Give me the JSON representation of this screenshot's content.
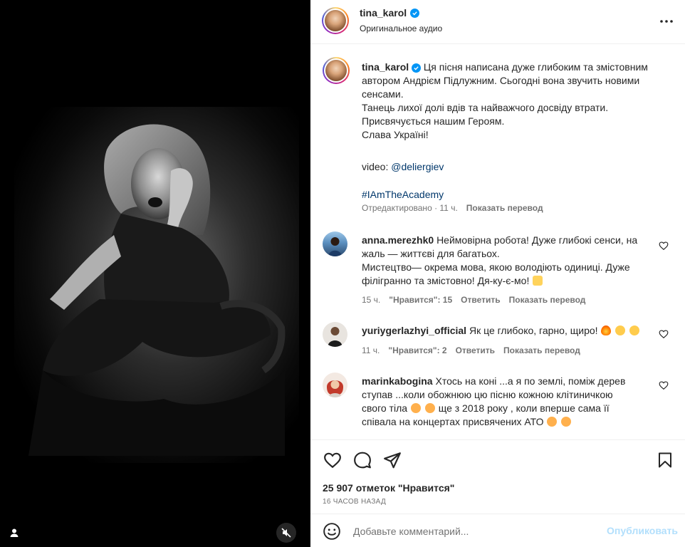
{
  "post": {
    "author": "tina_karol",
    "audio": "Оригинальное аудио",
    "caption_lines": [
      "Ця пісня написана дуже глибоким та змістовним",
      "автором Андрієм Підлужним. Сьогодні вона звучить новими",
      "сенсами.",
      "Танець лихої долі вдів та найважчого досвіду втрати.",
      "Присвячується нашим Героям.",
      "Слава Україні!"
    ],
    "video_label": "video: ",
    "video_mention": "@deliergiev",
    "hashtag": "#IAmTheAcademy",
    "edited": "Отредактировано · 11 ч.",
    "translate": "Показать перевод",
    "likes": "25 907 отметок \"Нравится\"",
    "posted_ago": "16 ЧАСОВ НАЗАД"
  },
  "comments": [
    {
      "user": "anna.merezhk0",
      "lines": [
        "Неймовірна робота! Дуже глибокі сенси, на",
        "жаль — життєві для багатьох.",
        "Мистецтво— окрема мова, якою володіють одиниці. Дуже",
        "філігранно та змістовно! Дя-ку-є-мо!"
      ],
      "time": "15 ч.",
      "likes": "\"Нравится\": 15",
      "reply": "Ответить",
      "translate": "Показать перевод"
    },
    {
      "user": "yuriygerlazhyi_official",
      "text": "Як це глибоко, гарно, щиро!",
      "time": "11 ч.",
      "likes": "\"Нравится\": 2",
      "reply": "Ответить",
      "translate": "Показать перевод"
    },
    {
      "user": "marinkabogina",
      "lines": [
        "Хтось на коні ...а я по землі, поміж дерев",
        "ступав ...коли обожнюю цю пісню кожною клітиничкою",
        "свого тіла",
        "ще з 2018 року , коли вперше сама її",
        "співала на концертах присвячених АТО"
      ]
    }
  ],
  "composer": {
    "placeholder": "Добавьте комментарий...",
    "publish": "Опубликовать"
  },
  "icons": {
    "more": "more-horizontal-icon",
    "like": "heart-icon",
    "comment": "comment-icon",
    "share": "share-icon",
    "save": "bookmark-icon",
    "emoji": "emoji-icon",
    "user_tag": "user-tag-icon",
    "mute": "sound-off-icon"
  },
  "colors": {
    "verified": "#0095f6",
    "link": "#00376b",
    "publish_disabled": "#b2dffc",
    "secondary_text": "#737373"
  }
}
